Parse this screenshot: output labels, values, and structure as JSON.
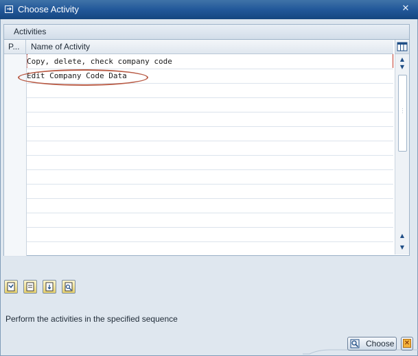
{
  "window": {
    "title": "Choose Activity"
  },
  "panel": {
    "title": "Activities"
  },
  "table": {
    "columns": [
      "P...",
      "Name of Activity"
    ],
    "rows": [
      "Copy, delete, check company code",
      "Edit Company Code Data",
      "",
      "",
      "",
      "",
      "",
      "",
      "",
      "",
      "",
      "",
      "",
      ""
    ]
  },
  "info_text": "Perform the activities in the specified sequence",
  "buttons": {
    "choose": "Choose"
  },
  "icons": {
    "title": "dialog-icon",
    "settings": "table-settings-icon",
    "toolbar": [
      "select-all-icon",
      "deselect-all-icon",
      "select-block-icon",
      "details-icon"
    ],
    "choose": "choose-icon",
    "cancel": "cancel-icon"
  },
  "colors": {
    "titlebar": "#22589a",
    "highlight_oval": "#b85a44",
    "button_gold": "#e4cf6d"
  }
}
